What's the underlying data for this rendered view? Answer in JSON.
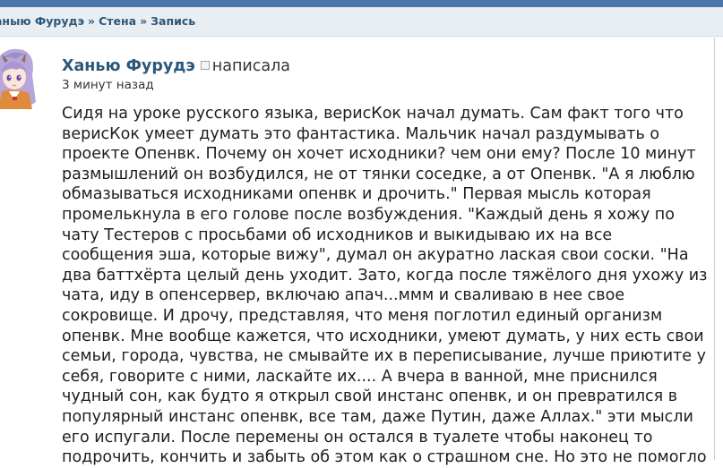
{
  "breadcrumb": {
    "items": [
      "аныю Фурудэ",
      "Стена",
      "Запись"
    ],
    "separator": "»"
  },
  "post": {
    "author": "Ханью Фурудэ",
    "action": "написала",
    "time": "3 минут назад",
    "lines": [
      "Сидя на уроке русского языка, верисКок начал думать. Сам факт того что",
      "верисКок умеет думать это фантастика. Мальчик начал раздумывать о",
      "проекте Опенвк. Почему он хочет исходники? чем они ему? После 10 минут",
      "размышлений он возбудился, не от тянки соседке, а от Опенвк. \"А я люблю",
      "обмазываться исходниками опенвк и дрочить.\" Первая мысль которая",
      "промелькнула в его голове после возбуждения. \"Каждый день я хожу по",
      "чату Тестеров с просьбами об исходников и выкидываю их на все",
      "сообщения эша, которые вижу\", думал он акуратно лаская свои соски. \"На",
      "два баттхёрта целый день уходит. Зато, когда после тяжёлого дня ухожу из",
      "чата, иду в опенсервер, включаю апач...ммм и сваливаю в нее свое",
      "сокровище. И дрочу, представляя, что меня поглотил единый организм",
      "опенвк. Мне вообще кажется, что исходники, умеют думать, у них есть свои",
      "семьи, города, чувства, не смывайте их в переписывание, лучше приютите у",
      "себя, говорите с ними, ласкайте их.... А вчера в ванной, мне приснился",
      "чудный сон, как будто я открыл свой инстанс опенвк, и он превратился в",
      "популярный инстанс опенвк, все там, даже Путин, даже Аллах.\" эти мысли",
      "его испугали. После перемены он остался в туалете чтобы наконец то",
      "подрочить, кончить и забыть об этом как о страшном сне. Но это не помогло"
    ]
  },
  "colors": {
    "header_blue": "#4a76a8",
    "breadcrumb_bg": "#e9eef3",
    "link": "#2b587a"
  },
  "icons": {
    "avatar": "anime-girl-avatar",
    "status": "status-box-icon"
  }
}
